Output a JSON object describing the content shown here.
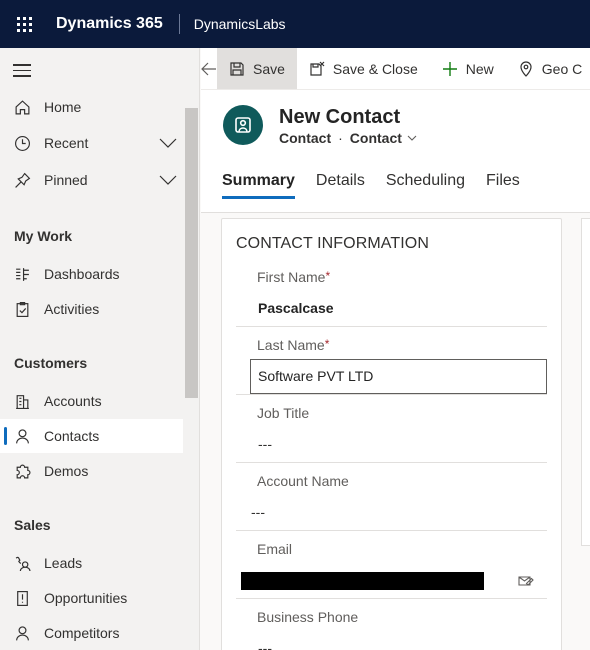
{
  "topbar": {
    "app_name": "Dynamics 365",
    "environment": "DynamicsLabs"
  },
  "sidebar": {
    "items": [
      {
        "label": "Home",
        "icon": "home-icon"
      },
      {
        "label": "Recent",
        "icon": "clock-icon",
        "expandable": true
      },
      {
        "label": "Pinned",
        "icon": "pin-icon",
        "expandable": true
      }
    ],
    "groups": [
      {
        "title": "My Work",
        "items": [
          {
            "label": "Dashboards",
            "icon": "dashboard-icon"
          },
          {
            "label": "Activities",
            "icon": "clipboard-icon"
          }
        ]
      },
      {
        "title": "Customers",
        "items": [
          {
            "label": "Accounts",
            "icon": "building-icon"
          },
          {
            "label": "Contacts",
            "icon": "person-icon",
            "selected": true
          },
          {
            "label": "Demos",
            "icon": "puzzle-icon"
          }
        ]
      },
      {
        "title": "Sales",
        "items": [
          {
            "label": "Leads",
            "icon": "phone-person-icon"
          },
          {
            "label": "Opportunities",
            "icon": "flag-icon"
          },
          {
            "label": "Competitors",
            "icon": "person-icon"
          }
        ]
      }
    ]
  },
  "commandbar": {
    "save": "Save",
    "save_close": "Save & Close",
    "new": "New",
    "geo": "Geo C"
  },
  "header": {
    "title": "New Contact",
    "entity": "Contact",
    "form": "Contact",
    "tabs": [
      "Summary",
      "Details",
      "Scheduling",
      "Files"
    ],
    "active_tab": "Summary"
  },
  "form": {
    "section_title": "CONTACT INFORMATION",
    "fields": [
      {
        "label": "First Name",
        "required_marker": "*",
        "value": "Pascalcase"
      },
      {
        "label": "Last Name",
        "required_marker": "*",
        "value": "Software PVT LTD"
      },
      {
        "label": "Job Title",
        "value": "---"
      },
      {
        "label": "Account Name",
        "value": "---"
      },
      {
        "label": "Email",
        "value": ""
      },
      {
        "label": "Business Phone",
        "value": "---"
      }
    ]
  },
  "colors": {
    "topbar": "#0b1a3b",
    "accent": "#0f6cbd",
    "avatar": "#0f5a5b",
    "required": "#a4262c"
  }
}
